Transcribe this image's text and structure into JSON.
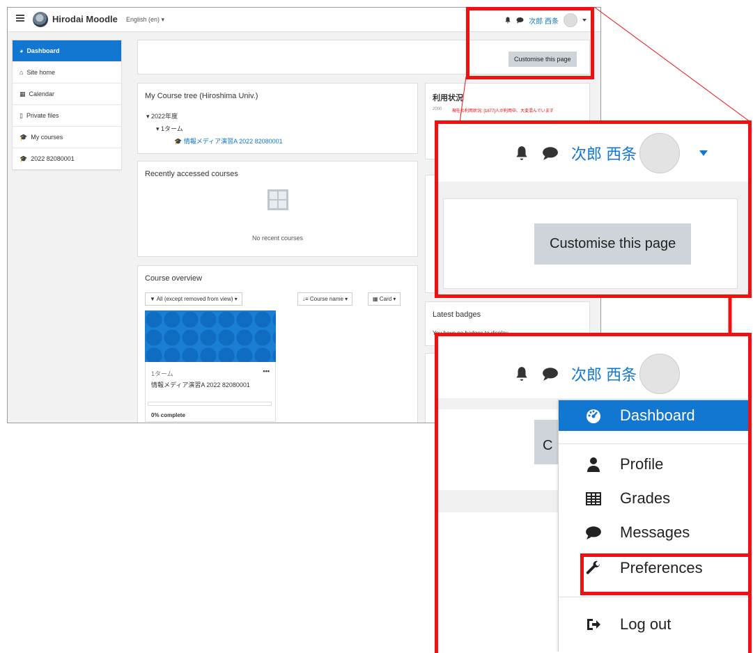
{
  "topbar": {
    "site_name": "Hirodai Moodle",
    "language": "English (en)",
    "user_name": "次郎 西条"
  },
  "sidebar": {
    "items": [
      {
        "label": "Dashboard"
      },
      {
        "label": "Site home"
      },
      {
        "label": "Calendar"
      },
      {
        "label": "Private files"
      },
      {
        "label": "My courses"
      },
      {
        "label": "2022 82080001"
      }
    ]
  },
  "main": {
    "customise_button": "Customise this page",
    "course_tree": {
      "title": "My Course tree (Hiroshima Univ.)",
      "year": "2022年度",
      "term": "1ターム",
      "course": "情報メディア演習A 2022 82080001"
    },
    "recent": {
      "title": "Recently accessed courses",
      "empty_text": "No recent courses"
    },
    "overview": {
      "title": "Course overview",
      "filter": "All (except removed from view)",
      "sort": "Course name",
      "view": "Card",
      "card_term": "1ターム",
      "card_more": "•••",
      "card_title": "情報メディア演習A 2022 82080001",
      "progress_text": "0% complete",
      "progress_percent": 0
    },
    "usage": {
      "title": "利用状況",
      "notice": "現在の利用状況: [1877]人が利用中、大変混んでいます",
      "axis_value": "2000"
    },
    "badges": {
      "title": "Latest badges",
      "empty_text": "You have no badges to display"
    }
  },
  "zoom_menu": {
    "items": [
      {
        "label": "Dashboard",
        "icon": "dashboard-icon"
      },
      {
        "label": "Profile",
        "icon": "user-icon"
      },
      {
        "label": "Grades",
        "icon": "table-icon"
      },
      {
        "label": "Messages",
        "icon": "comment-icon"
      },
      {
        "label": "Preferences",
        "icon": "wrench-icon"
      },
      {
        "label": "Log out",
        "icon": "logout-icon"
      }
    ],
    "partial_button_letter": "C"
  },
  "colors": {
    "accent": "#1177d1",
    "highlight": "#ee1111",
    "button_gray": "#ced4da"
  }
}
